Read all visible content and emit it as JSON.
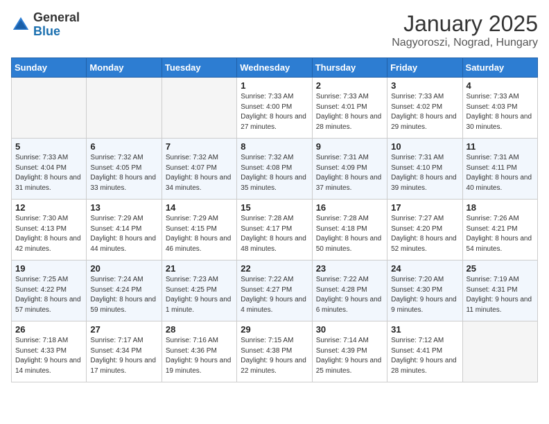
{
  "logo": {
    "general": "General",
    "blue": "Blue"
  },
  "header": {
    "month": "January 2025",
    "location": "Nagyoroszi, Nograd, Hungary"
  },
  "weekdays": [
    "Sunday",
    "Monday",
    "Tuesday",
    "Wednesday",
    "Thursday",
    "Friday",
    "Saturday"
  ],
  "weeks": [
    [
      {
        "day": "",
        "info": ""
      },
      {
        "day": "",
        "info": ""
      },
      {
        "day": "",
        "info": ""
      },
      {
        "day": "1",
        "info": "Sunrise: 7:33 AM\nSunset: 4:00 PM\nDaylight: 8 hours and 27 minutes."
      },
      {
        "day": "2",
        "info": "Sunrise: 7:33 AM\nSunset: 4:01 PM\nDaylight: 8 hours and 28 minutes."
      },
      {
        "day": "3",
        "info": "Sunrise: 7:33 AM\nSunset: 4:02 PM\nDaylight: 8 hours and 29 minutes."
      },
      {
        "day": "4",
        "info": "Sunrise: 7:33 AM\nSunset: 4:03 PM\nDaylight: 8 hours and 30 minutes."
      }
    ],
    [
      {
        "day": "5",
        "info": "Sunrise: 7:33 AM\nSunset: 4:04 PM\nDaylight: 8 hours and 31 minutes."
      },
      {
        "day": "6",
        "info": "Sunrise: 7:32 AM\nSunset: 4:05 PM\nDaylight: 8 hours and 33 minutes."
      },
      {
        "day": "7",
        "info": "Sunrise: 7:32 AM\nSunset: 4:07 PM\nDaylight: 8 hours and 34 minutes."
      },
      {
        "day": "8",
        "info": "Sunrise: 7:32 AM\nSunset: 4:08 PM\nDaylight: 8 hours and 35 minutes."
      },
      {
        "day": "9",
        "info": "Sunrise: 7:31 AM\nSunset: 4:09 PM\nDaylight: 8 hours and 37 minutes."
      },
      {
        "day": "10",
        "info": "Sunrise: 7:31 AM\nSunset: 4:10 PM\nDaylight: 8 hours and 39 minutes."
      },
      {
        "day": "11",
        "info": "Sunrise: 7:31 AM\nSunset: 4:11 PM\nDaylight: 8 hours and 40 minutes."
      }
    ],
    [
      {
        "day": "12",
        "info": "Sunrise: 7:30 AM\nSunset: 4:13 PM\nDaylight: 8 hours and 42 minutes."
      },
      {
        "day": "13",
        "info": "Sunrise: 7:29 AM\nSunset: 4:14 PM\nDaylight: 8 hours and 44 minutes."
      },
      {
        "day": "14",
        "info": "Sunrise: 7:29 AM\nSunset: 4:15 PM\nDaylight: 8 hours and 46 minutes."
      },
      {
        "day": "15",
        "info": "Sunrise: 7:28 AM\nSunset: 4:17 PM\nDaylight: 8 hours and 48 minutes."
      },
      {
        "day": "16",
        "info": "Sunrise: 7:28 AM\nSunset: 4:18 PM\nDaylight: 8 hours and 50 minutes."
      },
      {
        "day": "17",
        "info": "Sunrise: 7:27 AM\nSunset: 4:20 PM\nDaylight: 8 hours and 52 minutes."
      },
      {
        "day": "18",
        "info": "Sunrise: 7:26 AM\nSunset: 4:21 PM\nDaylight: 8 hours and 54 minutes."
      }
    ],
    [
      {
        "day": "19",
        "info": "Sunrise: 7:25 AM\nSunset: 4:22 PM\nDaylight: 8 hours and 57 minutes."
      },
      {
        "day": "20",
        "info": "Sunrise: 7:24 AM\nSunset: 4:24 PM\nDaylight: 8 hours and 59 minutes."
      },
      {
        "day": "21",
        "info": "Sunrise: 7:23 AM\nSunset: 4:25 PM\nDaylight: 9 hours and 1 minute."
      },
      {
        "day": "22",
        "info": "Sunrise: 7:22 AM\nSunset: 4:27 PM\nDaylight: 9 hours and 4 minutes."
      },
      {
        "day": "23",
        "info": "Sunrise: 7:22 AM\nSunset: 4:28 PM\nDaylight: 9 hours and 6 minutes."
      },
      {
        "day": "24",
        "info": "Sunrise: 7:20 AM\nSunset: 4:30 PM\nDaylight: 9 hours and 9 minutes."
      },
      {
        "day": "25",
        "info": "Sunrise: 7:19 AM\nSunset: 4:31 PM\nDaylight: 9 hours and 11 minutes."
      }
    ],
    [
      {
        "day": "26",
        "info": "Sunrise: 7:18 AM\nSunset: 4:33 PM\nDaylight: 9 hours and 14 minutes."
      },
      {
        "day": "27",
        "info": "Sunrise: 7:17 AM\nSunset: 4:34 PM\nDaylight: 9 hours and 17 minutes."
      },
      {
        "day": "28",
        "info": "Sunrise: 7:16 AM\nSunset: 4:36 PM\nDaylight: 9 hours and 19 minutes."
      },
      {
        "day": "29",
        "info": "Sunrise: 7:15 AM\nSunset: 4:38 PM\nDaylight: 9 hours and 22 minutes."
      },
      {
        "day": "30",
        "info": "Sunrise: 7:14 AM\nSunset: 4:39 PM\nDaylight: 9 hours and 25 minutes."
      },
      {
        "day": "31",
        "info": "Sunrise: 7:12 AM\nSunset: 4:41 PM\nDaylight: 9 hours and 28 minutes."
      },
      {
        "day": "",
        "info": ""
      }
    ]
  ]
}
